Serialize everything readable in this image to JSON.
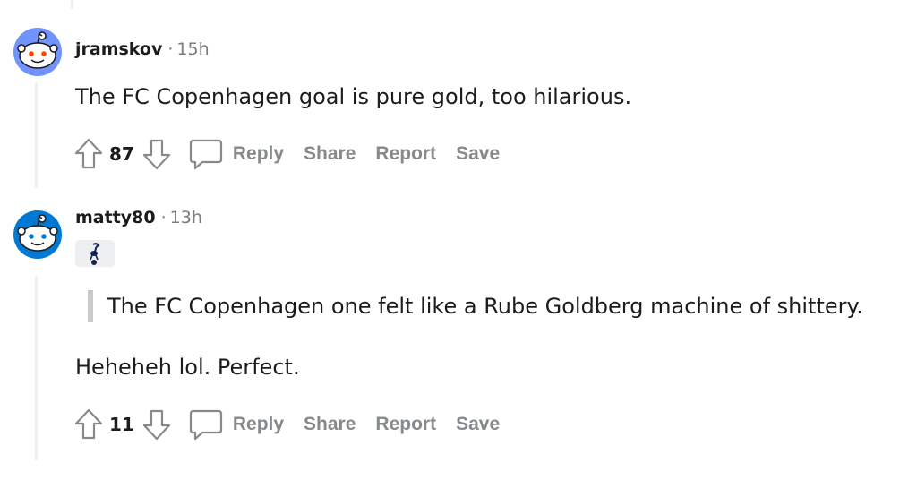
{
  "comments": [
    {
      "username": "jramskov",
      "separator": "·",
      "time": "15h",
      "text": "The FC Copenhagen goal is pure gold, too hilarious.",
      "votes": "87",
      "actions": {
        "reply": "Reply",
        "share": "Share",
        "report": "Report",
        "save": "Save"
      },
      "avatar_color": "#7193ff",
      "icons": [
        "upvote-icon",
        "downvote-icon",
        "comment-icon"
      ]
    },
    {
      "username": "matty80",
      "separator": "·",
      "time": "13h",
      "flair_icon": "tottenham-cockerel-icon",
      "quote": "The FC Copenhagen one felt like a Rube Goldberg machine of shittery.",
      "text": "Heheheh lol. Perfect.",
      "votes": "11",
      "actions": {
        "reply": "Reply",
        "share": "Share",
        "report": "Report",
        "save": "Save"
      },
      "avatar_color": "#0079d3",
      "icons": [
        "upvote-icon",
        "downvote-icon",
        "comment-icon"
      ]
    }
  ]
}
